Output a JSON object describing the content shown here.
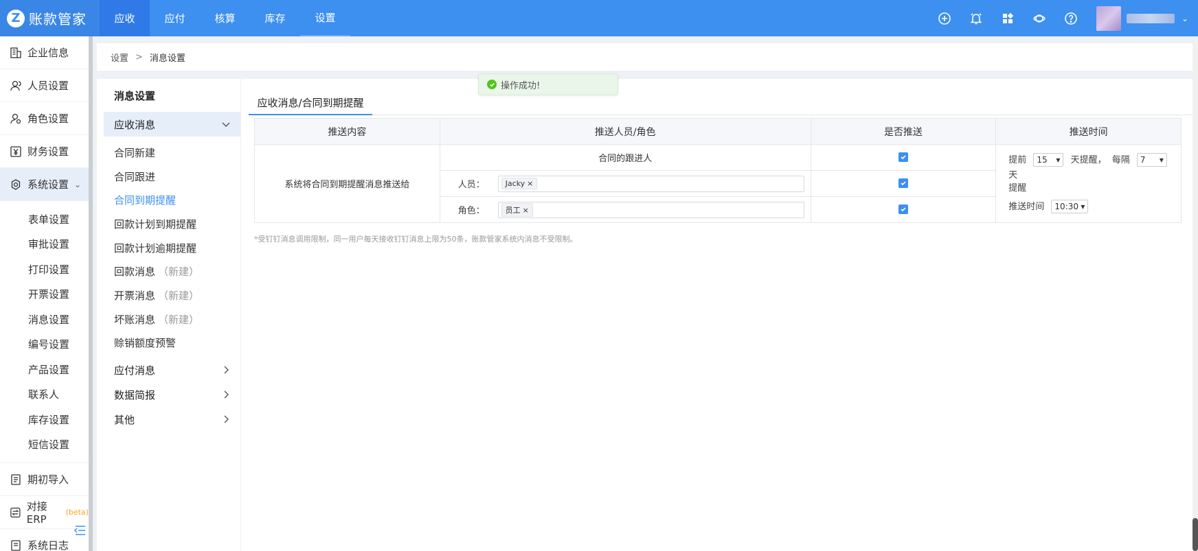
{
  "app": {
    "logo_letter": "Z",
    "title": "账款管家"
  },
  "topnav": [
    {
      "label": "应收"
    },
    {
      "label": "应付"
    },
    {
      "label": "核算"
    },
    {
      "label": "库存"
    },
    {
      "label": "设置"
    }
  ],
  "top_icons": [
    "add-circle-icon",
    "bell-icon",
    "apps-grid-icon",
    "headset-icon",
    "help-icon"
  ],
  "sidebar": {
    "items_top": [
      {
        "label": "企业信息",
        "icon": "building-icon"
      },
      {
        "label": "人员设置",
        "icon": "user-icon"
      },
      {
        "label": "角色设置",
        "icon": "role-icon"
      },
      {
        "label": "财务设置",
        "icon": "yen-icon"
      },
      {
        "label": "系统设置",
        "icon": "system-gear-icon"
      }
    ],
    "system_children": [
      {
        "label": "表单设置"
      },
      {
        "label": "审批设置"
      },
      {
        "label": "打印设置"
      },
      {
        "label": "开票设置"
      },
      {
        "label": "消息设置"
      },
      {
        "label": "编号设置"
      },
      {
        "label": "产品设置"
      },
      {
        "label": "联系人"
      },
      {
        "label": "库存设置"
      },
      {
        "label": "短信设置"
      }
    ],
    "items_bottom": [
      {
        "label": "期初导入",
        "icon": "import-icon"
      },
      {
        "label": "对接ERP",
        "badge": "(beta)",
        "icon": "erp-icon"
      },
      {
        "label": "系统日志",
        "icon": "log-icon"
      }
    ]
  },
  "breadcrumb": {
    "root": "设置",
    "sep": ">",
    "current": "消息设置"
  },
  "submenu": {
    "title": "消息设置",
    "group_open": "应收消息",
    "items": [
      {
        "label": "合同新建",
        "suffix": ""
      },
      {
        "label": "合同跟进",
        "suffix": ""
      },
      {
        "label": "合同到期提醒",
        "suffix": ""
      },
      {
        "label": "回款计划到期提醒",
        "suffix": ""
      },
      {
        "label": "回款计划逾期提醒",
        "suffix": ""
      },
      {
        "label": "回款消息",
        "suffix": "（新建）"
      },
      {
        "label": "开票消息",
        "suffix": "（新建）"
      },
      {
        "label": "坏账消息",
        "suffix": "（新建）"
      },
      {
        "label": "赊销额度预警",
        "suffix": ""
      }
    ],
    "groups_closed": [
      {
        "label": "应付消息"
      },
      {
        "label": "数据简报"
      },
      {
        "label": "其他"
      }
    ]
  },
  "tab": {
    "label": "应收消息/合同到期提醒"
  },
  "table": {
    "headers": [
      "推送内容",
      "推送人员/角色",
      "是否推送",
      "推送时间"
    ],
    "content_text": "系统将合同到期提醒消息推送给",
    "row_follower": "合同的跟进人",
    "row_person_label": "人员：",
    "row_person_tag": "Jacky",
    "row_role_label": "角色：",
    "row_role_tag": "员工",
    "tag_close": "×",
    "time": {
      "before_label": "提前",
      "before_value": "15",
      "remind_label": "天提醒，",
      "interval_label": "每隔",
      "interval_value": "7",
      "interval_unit": "天",
      "remind_word": "提醒",
      "send_time_label": "推送时间",
      "send_time_value": "10:30"
    }
  },
  "note": "*受钉钉消息调用限制，同一用户每天接收钉钉消息上限为50条，账款管家系统内消息不受限制。",
  "toast": {
    "text": "操作成功!"
  },
  "colors": {
    "primary": "#3d8ff0",
    "success": "#52c41a"
  }
}
